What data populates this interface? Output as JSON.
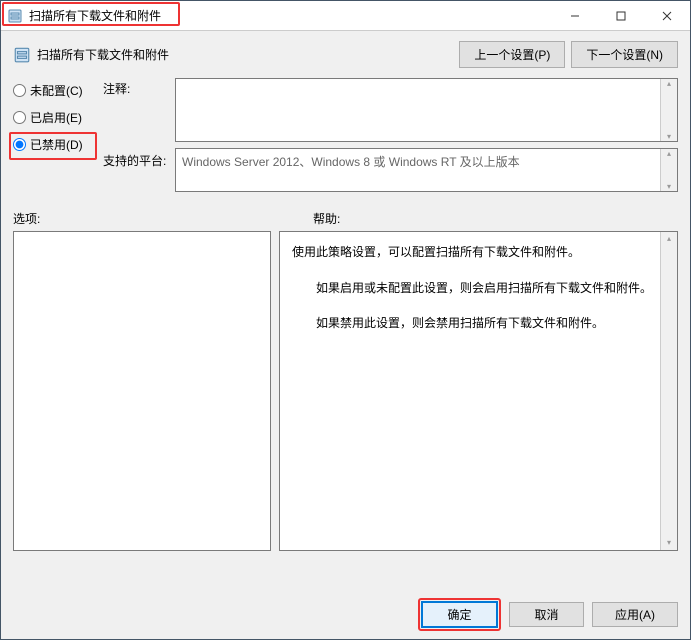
{
  "window": {
    "title": "扫描所有下载文件和附件",
    "subtitle": "扫描所有下载文件和附件"
  },
  "nav": {
    "prev": "上一个设置(P)",
    "next": "下一个设置(N)"
  },
  "radios": {
    "not_configured": "未配置(C)",
    "enabled": "已启用(E)",
    "disabled": "已禁用(D)",
    "selected": "disabled"
  },
  "labels": {
    "notes": "注释:",
    "platforms": "支持的平台:",
    "options": "选项:",
    "help": "帮助:"
  },
  "fields": {
    "notes": "",
    "platforms": "Windows Server 2012、Windows 8 或 Windows RT 及以上版本"
  },
  "help": {
    "p1": "使用此策略设置，可以配置扫描所有下载文件和附件。",
    "p2": "如果启用或未配置此设置，则会启用扫描所有下载文件和附件。",
    "p3": "如果禁用此设置，则会禁用扫描所有下载文件和附件。"
  },
  "footer": {
    "ok": "确定",
    "cancel": "取消",
    "apply": "应用(A)"
  }
}
